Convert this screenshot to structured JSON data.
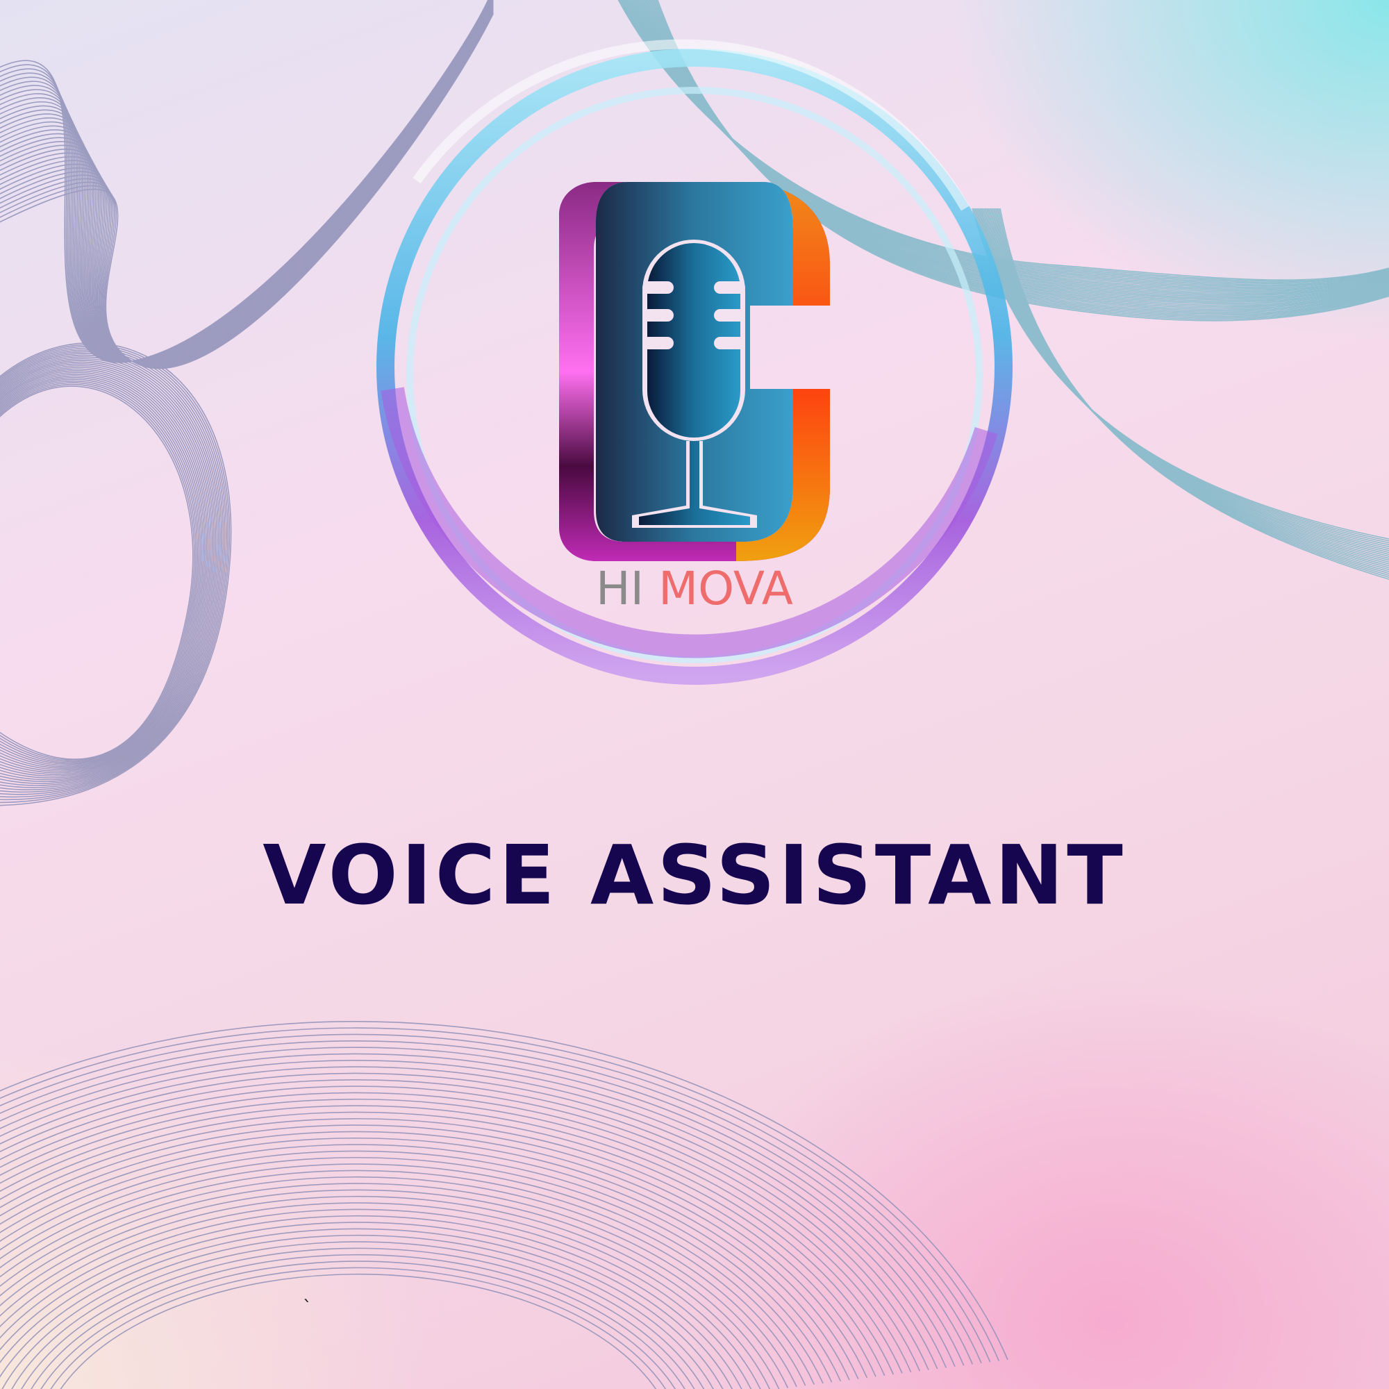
{
  "logo": {
    "brand_prefix": "HI",
    "brand_name": "MOVA",
    "icon": "microphone-icon",
    "monogram": "G",
    "colors": {
      "prefix": "#8a8a8a",
      "name": "#ee6c6c",
      "ring_blue": "#3fb0e6",
      "ring_purple": "#9a4fdc",
      "mic": "#1a6f98"
    }
  },
  "headline": {
    "text": "VOICE ASSISTANT",
    "color": "#16064f"
  },
  "stray_mark": "`",
  "background": {
    "colors": [
      "#e4e2f2",
      "#f6dcee",
      "#78e8e8",
      "#f4c8dc"
    ],
    "line_colors": [
      "#8f90b8",
      "#7fb8c8"
    ]
  }
}
